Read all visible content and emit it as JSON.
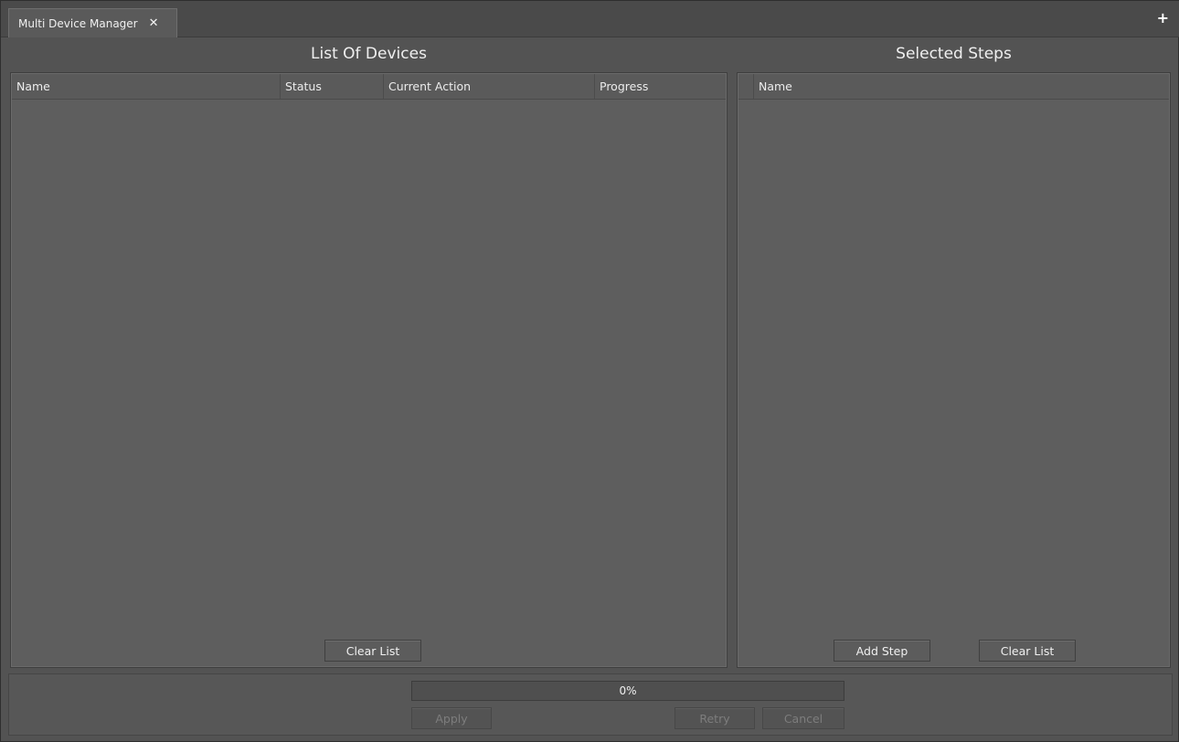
{
  "tab": {
    "label": "Multi Device Manager",
    "close_glyph": "✕",
    "close_icon": "close-icon"
  },
  "add_tab_glyph": "+",
  "devices_panel": {
    "title": "List Of Devices",
    "columns": [
      "Name",
      "Status",
      "Current Action",
      "Progress"
    ],
    "rows": [],
    "clear_label": "Clear List"
  },
  "steps_panel": {
    "title": "Selected Steps",
    "columns": [
      "Name"
    ],
    "rows": [],
    "add_label": "Add Step",
    "clear_label": "Clear List"
  },
  "footer": {
    "progress_text": "0%",
    "progress_value": 0,
    "apply_label": "Apply",
    "retry_label": "Retry",
    "cancel_label": "Cancel"
  },
  "colors": {
    "progress_fill": "#6b8fb4"
  }
}
